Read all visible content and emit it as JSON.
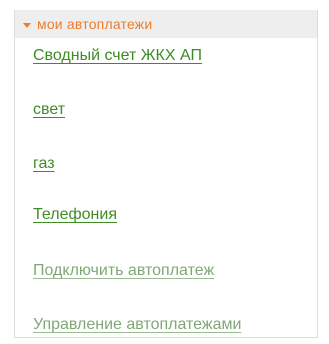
{
  "autopayments": {
    "header_title": "мои автоплатежи",
    "items": [
      {
        "label": "Сводный счет ЖКХ АП"
      },
      {
        "label": "свет"
      },
      {
        "label": "газ"
      },
      {
        "label": "Телефония"
      }
    ],
    "actions": [
      {
        "label": "Подключить автоплатеж"
      },
      {
        "label": "Управление автоплатежами"
      }
    ],
    "colors": {
      "header_text": "#ef7d2c",
      "header_bg": "#eeeeee",
      "link": "#3f8c25",
      "secondary_link": "#80a876"
    }
  }
}
